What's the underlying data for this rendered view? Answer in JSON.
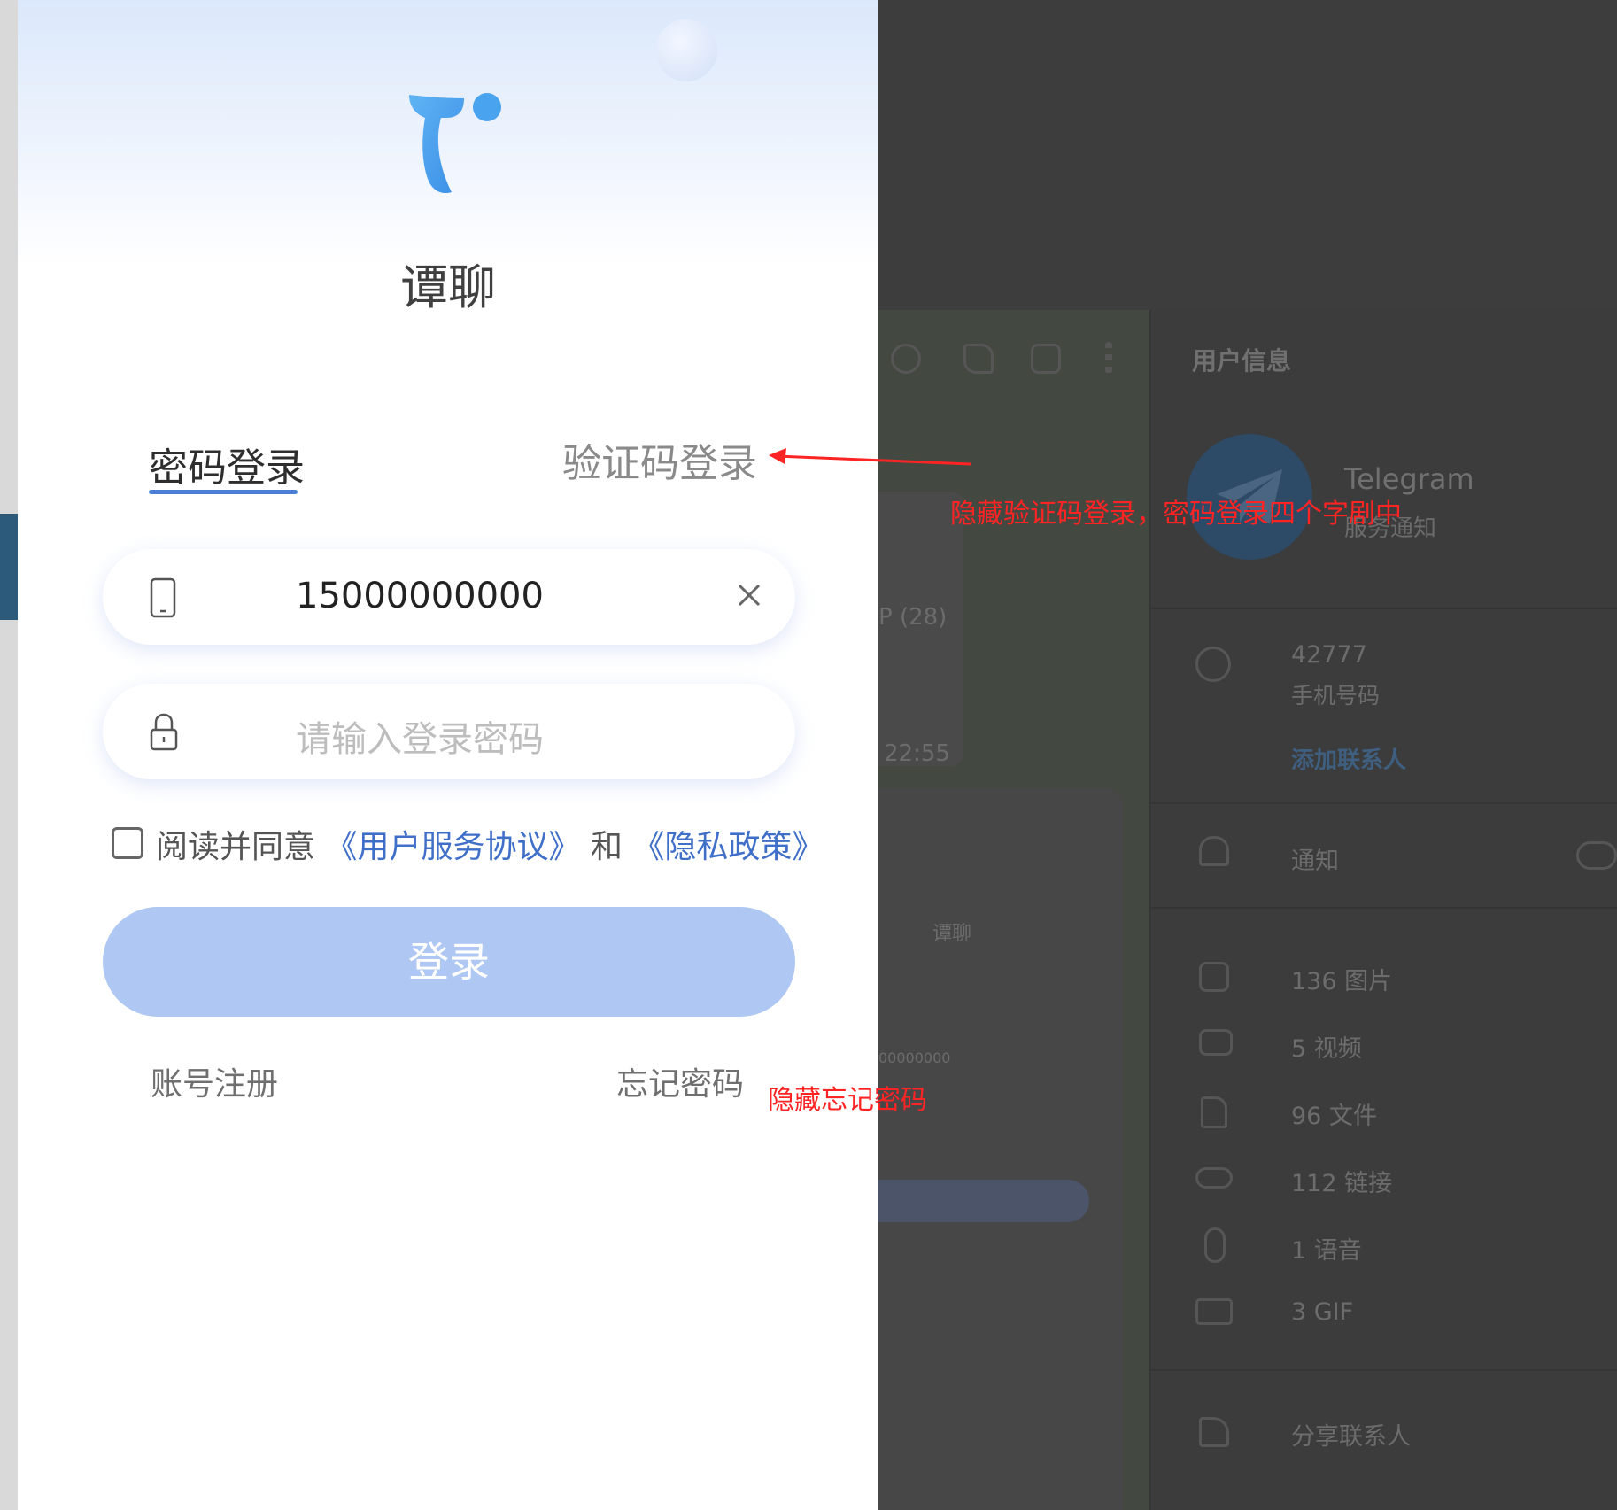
{
  "app": {
    "name": "谭聊",
    "tabs": [
      "密码登录",
      "验证码登录"
    ],
    "phone_value": "15000000000",
    "password_placeholder": "请输入登录密码",
    "agree_prefix": "阅读并同意",
    "agree_link_terms": "《用户服务协议》",
    "agree_and": "和",
    "agree_link_privacy": "《隐私政策》",
    "login_label": "登录",
    "register_label": "账号注册",
    "forgot_label": "忘记密码"
  },
  "annotations": {
    "note_1": "隐藏验证码登录，密码登录四个字剧中",
    "note_2": "隐藏忘记密码",
    "color": "#ff2424"
  },
  "background": {
    "user_info_title": "用户信息",
    "contact_name": "Telegram",
    "contact_subtitle": "服务通知",
    "chat_count": "P (28)",
    "chat_time": "22:55",
    "phone_number": "42777",
    "phone_label": "手机号码",
    "add_contact": "添加联系人",
    "notifications": "通知",
    "media": [
      {
        "icon": "image-icon",
        "label": "136 图片"
      },
      {
        "icon": "video-icon",
        "label": "5 视频"
      },
      {
        "icon": "file-icon",
        "label": "96 文件"
      },
      {
        "icon": "link-icon",
        "label": "112 链接"
      },
      {
        "icon": "mic-icon",
        "label": "1 语音"
      },
      {
        "icon": "gif-icon",
        "label": "3 GIF"
      }
    ],
    "share_contact": "分享联系人",
    "mini_app_name": "谭聊",
    "mini_phone": "00000000"
  },
  "colors": {
    "accent": "#4a7fd8",
    "button": "#aec7f3",
    "link": "#3f6fc8"
  }
}
